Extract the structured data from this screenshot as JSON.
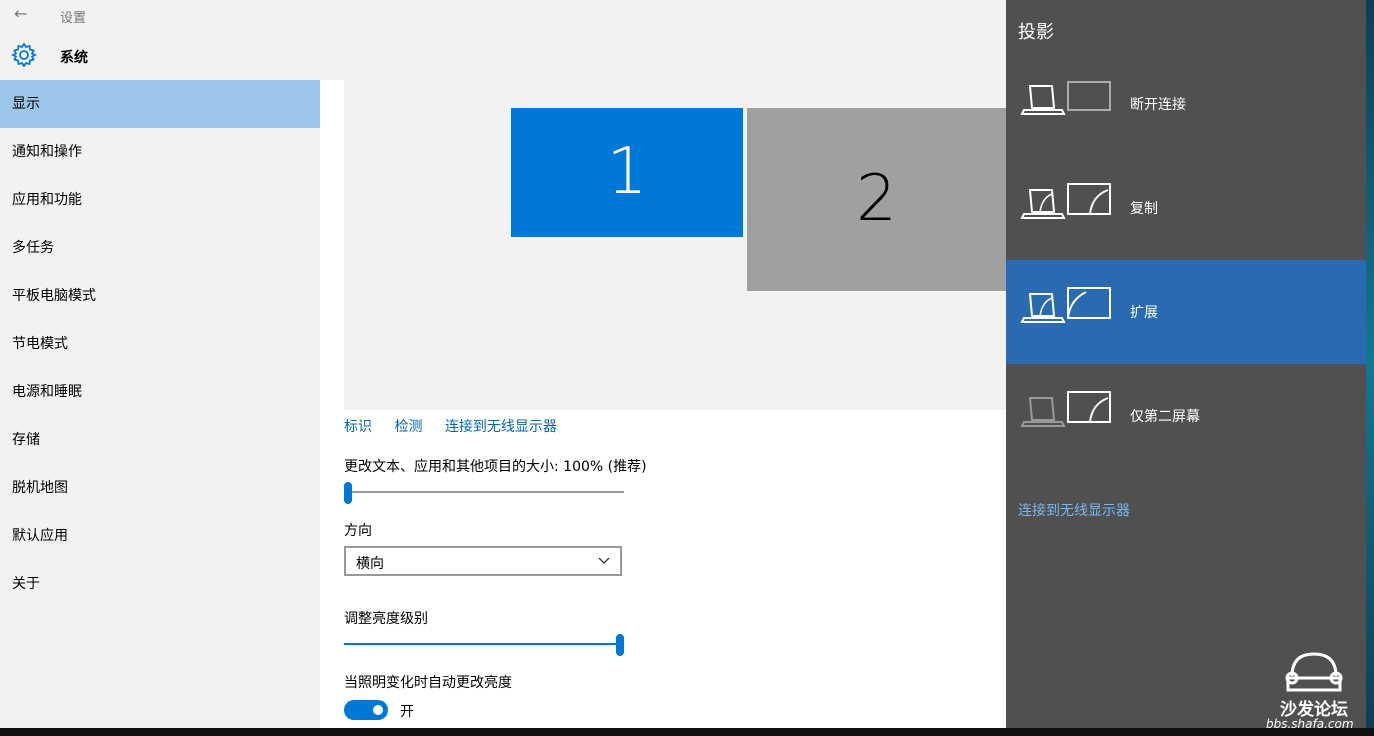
{
  "window": {
    "title": "设置",
    "back": "←"
  },
  "header": {
    "section": "系统"
  },
  "sidebar": {
    "items": [
      {
        "label": "显示"
      },
      {
        "label": "通知和操作"
      },
      {
        "label": "应用和功能"
      },
      {
        "label": "多任务"
      },
      {
        "label": "平板电脑模式"
      },
      {
        "label": "节电模式"
      },
      {
        "label": "电源和睡眠"
      },
      {
        "label": "存储"
      },
      {
        "label": "脱机地图"
      },
      {
        "label": "默认应用"
      },
      {
        "label": "关于"
      }
    ]
  },
  "display": {
    "monitor1": "1",
    "monitor2": "2",
    "links": {
      "identify": "标识",
      "detect": "检测",
      "connect": "连接到无线显示器"
    },
    "scale_label": "更改文本、应用和其他项目的大小: 100% (推荐)",
    "scale_value": 0,
    "orientation_label": "方向",
    "orientation_value": "横向",
    "brightness_label": "调整亮度级别",
    "brightness_value": 1.0,
    "auto_brightness_label": "当照明变化时自动更改亮度",
    "auto_brightness_state": "开"
  },
  "project_panel": {
    "title": "投影",
    "options": [
      {
        "label": "断开连接"
      },
      {
        "label": "复制"
      },
      {
        "label": "扩展"
      },
      {
        "label": "仅第二屏幕"
      }
    ],
    "selected": "扩展",
    "connect_link": "连接到无线显示器"
  },
  "watermark": {
    "text": "沙发论坛",
    "url": "bbs.shafa.com"
  },
  "colors": {
    "accent": "#0078d7",
    "selected_nav": "#9cc5ea",
    "panel_bg": "#505050",
    "panel_selected": "#2a6ab0",
    "link": "#0067b8"
  }
}
